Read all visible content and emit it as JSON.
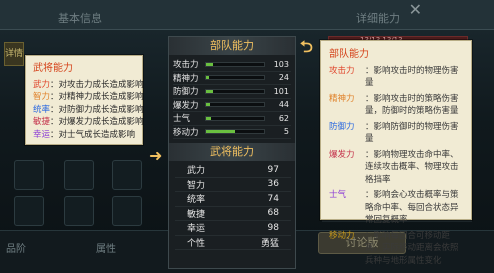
{
  "background": {
    "tab_left": "基本信息",
    "tab_right": "详细能力",
    "hp_text": "13/13 13/13",
    "side_button": "详情",
    "bottom_left": "品阶",
    "bottom_mid": "属性",
    "bottom_button": "讨论版"
  },
  "left_tip": {
    "title": "武将能力",
    "rows": [
      {
        "name": "武力",
        "desc": "：对攻击力成长造成影响",
        "color": "#e0442a"
      },
      {
        "name": "智力",
        "desc": "：对精神力成长造成影响",
        "color": "#e0822a"
      },
      {
        "name": "统率",
        "desc": "：对防御力成长造成影响",
        "color": "#2a68e0"
      },
      {
        "name": "敏捷",
        "desc": "：对爆发力成长造成影响",
        "color": "#c4304a"
      },
      {
        "name": "幸运",
        "desc": "：对士气成长造成影响",
        "color": "#8a3ad6"
      }
    ]
  },
  "center": {
    "unit_header": "部队能力",
    "unit_rows": [
      {
        "label": "攻击力",
        "value": "103",
        "fill": 0.12
      },
      {
        "label": "精神力",
        "value": "24",
        "fill": 0.05
      },
      {
        "label": "防御力",
        "value": "101",
        "fill": 0.12
      },
      {
        "label": "爆发力",
        "value": "44",
        "fill": 0.07
      },
      {
        "label": "士气",
        "value": "62",
        "fill": 0.09
      },
      {
        "label": "移动力",
        "value": "5",
        "fill": 0.5
      }
    ],
    "general_header": "武将能力",
    "general_rows": [
      {
        "label": "武力",
        "value": "97"
      },
      {
        "label": "智力",
        "value": "36"
      },
      {
        "label": "统率",
        "value": "74"
      },
      {
        "label": "敏捷",
        "value": "68"
      },
      {
        "label": "幸运",
        "value": "98"
      },
      {
        "label": "个性",
        "value": "勇猛"
      }
    ]
  },
  "right_tip": {
    "title": "部队能力",
    "rows": [
      {
        "name": "攻击力",
        "desc": "：影响攻击时的物理伤害量",
        "cls": "c-red"
      },
      {
        "name": "精神力",
        "desc": "：影响攻击时的策略伤害量，防御时的策略伤害量",
        "cls": "c-orange"
      },
      {
        "name": "防御力",
        "desc": "：影响防御时的物理伤害量",
        "cls": "c-blue"
      },
      {
        "name": "爆发力",
        "desc": "：影响物理攻击命中率、连续攻击概率、物理攻击格挡率",
        "cls": "c-darkred"
      },
      {
        "name": "士气",
        "desc": "：影响会心攻击概率与策略命中率、每回合状态异常回复概率",
        "cls": "c-purple"
      },
      {
        "name": "移动力",
        "desc": "：影响每回合可移动距离，实际移动距离会依照兵种与地形属性变化",
        "cls": "c-yellow"
      }
    ]
  },
  "colors": {
    "accent_gold": "#f0c060",
    "bar_green": "#6ac040",
    "tip_title": "#d5441c",
    "parchment": "#f1ebd4"
  }
}
